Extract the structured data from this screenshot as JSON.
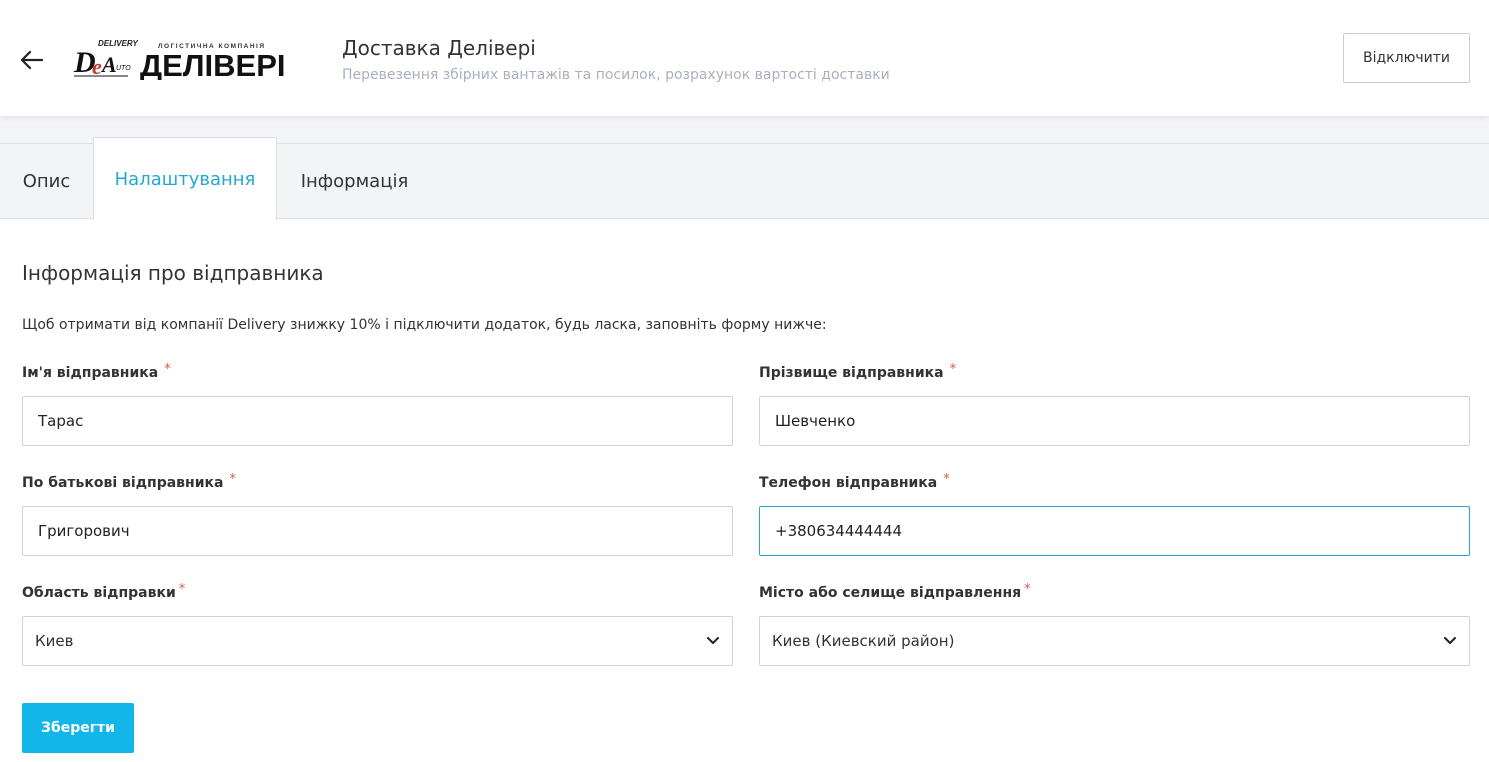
{
  "header": {
    "logo_text": "ДЕЛІВЕРІ",
    "logo_small_text": "ЛОГІСТИЧНА КОМПАНІЯ",
    "logo_mark": "DELIVERY",
    "title": "Доставка Делівері",
    "subtitle": "Перевезення збірних вантажів та посилок, розрахунок вартості доставки",
    "disconnect_label": "Відключити"
  },
  "tabs": [
    {
      "label": "Опис",
      "active": false
    },
    {
      "label": "Налаштування",
      "active": true
    },
    {
      "label": "Інформація",
      "active": false
    }
  ],
  "section": {
    "title": "Інформація про відправника",
    "intro": "Щоб отримати від компанії Delivery знижку 10% і підключити додаток, будь ласка, заповніть форму нижче:"
  },
  "form": {
    "first_name": {
      "label": "Ім'я відправника",
      "value": "Тарас"
    },
    "last_name": {
      "label": "Прізвище відправника",
      "value": "Шевченко"
    },
    "patronymic": {
      "label": "По батькові відправника",
      "value": "Григорович"
    },
    "phone": {
      "label": "Телефон відправника",
      "value": "+380634444444"
    },
    "region": {
      "label": "Область відправки",
      "value": "Киев"
    },
    "city": {
      "label": "Місто або селище відправлення",
      "value": "Киев (Киевский район)"
    },
    "required_mark": "*",
    "save_label": "Зберегти"
  },
  "colors": {
    "accent": "#25a7d6",
    "button": "#12b6e9",
    "required": "#e4554a"
  }
}
